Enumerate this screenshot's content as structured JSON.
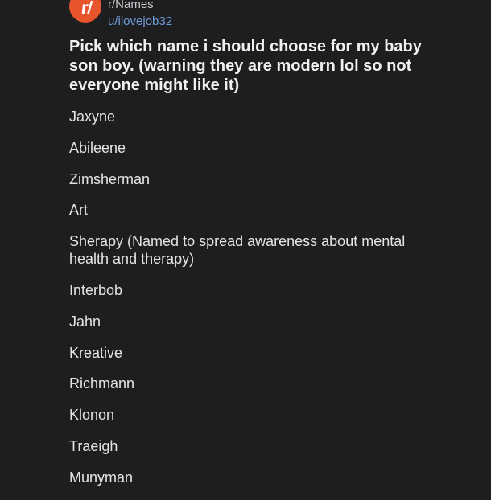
{
  "post": {
    "subreddit_icon_text": "r/",
    "subreddit": "r/Names",
    "author": "u/ilovejob32",
    "title": "Pick which name i should choose for my baby son boy. (warning they are modern lol so not everyone might like it)",
    "names": [
      "Jaxyne",
      "Abileene",
      "Zimsherman",
      "Art",
      "Sherapy (Named to spread awareness about mental health and therapy)",
      "Interbob",
      "Jahn",
      "Kreative",
      "Richmann",
      "Klonon",
      "Traeigh",
      "Munyman"
    ]
  },
  "colors": {
    "background": "#1e1e20",
    "subreddit_icon": "#e8542c",
    "username": "#6f9bd6",
    "text": "#e9e9ea"
  }
}
